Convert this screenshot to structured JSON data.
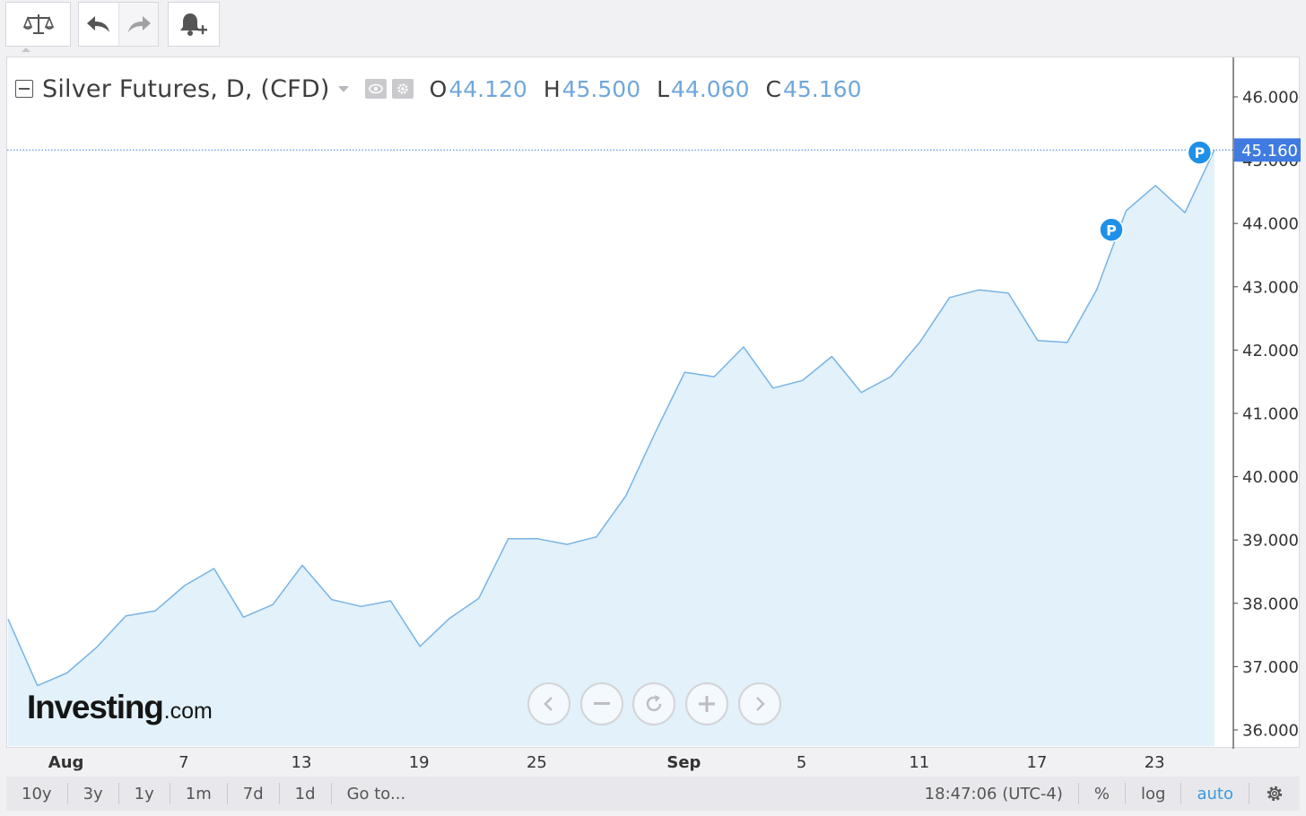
{
  "toolbar": {
    "compare_icon": "scale-icon",
    "undo_icon": "undo-arrow-icon",
    "redo_icon": "redo-arrow-icon",
    "alert_icon": "bell-plus-icon"
  },
  "legend": {
    "title": "Silver Futures, D, (CFD)",
    "open_label": "O",
    "open_value": "44.120",
    "high_label": "H",
    "high_value": "45.500",
    "low_label": "L",
    "low_value": "44.060",
    "close_label": "C",
    "close_value": "45.160"
  },
  "logo": {
    "main": "Investing",
    "suffix": ".com"
  },
  "colors": {
    "line": "#78b3e4",
    "fill": "#e2f1fa",
    "price_tag": "#3f7be0",
    "marker": "#1e90e8",
    "ohlc_value": "#70a7dc"
  },
  "chart_data": {
    "type": "area",
    "symbol": "Silver Futures, D, (CFD)",
    "y_ticks": [
      "36.000",
      "37.000",
      "38.000",
      "39.000",
      "40.000",
      "41.000",
      "42.000",
      "43.000",
      "44.000",
      "45.000",
      "46.000"
    ],
    "ylim": [
      35.7,
      46.4
    ],
    "x_tick_labels": [
      {
        "label": "Aug",
        "bold": true,
        "index": 2
      },
      {
        "label": "7",
        "bold": false,
        "index": 6
      },
      {
        "label": "13",
        "bold": false,
        "index": 10
      },
      {
        "label": "19",
        "bold": false,
        "index": 14
      },
      {
        "label": "25",
        "bold": false,
        "index": 18
      },
      {
        "label": "Sep",
        "bold": true,
        "index": 23
      },
      {
        "label": "5",
        "bold": false,
        "index": 27
      },
      {
        "label": "11",
        "bold": false,
        "index": 31
      },
      {
        "label": "17",
        "bold": false,
        "index": 35
      },
      {
        "label": "23",
        "bold": false,
        "index": 39
      }
    ],
    "values": [
      37.75,
      36.7,
      36.9,
      37.3,
      37.8,
      37.88,
      38.28,
      38.55,
      37.78,
      37.98,
      38.6,
      38.06,
      37.95,
      38.04,
      37.32,
      37.76,
      38.08,
      39.02,
      39.02,
      38.93,
      39.05,
      39.7,
      40.7,
      41.65,
      41.58,
      42.05,
      41.4,
      41.52,
      41.9,
      41.33,
      41.58,
      42.13,
      42.83,
      42.95,
      42.9,
      42.15,
      42.12,
      42.95,
      44.2,
      44.6,
      44.17,
      45.16
    ],
    "current_price": "45.160",
    "markers": [
      {
        "label": "P",
        "index": 37.5,
        "value": 43.9
      },
      {
        "label": "P",
        "index": 40.5,
        "value": 45.12
      }
    ]
  },
  "bottom_bar": {
    "ranges": [
      "10y",
      "3y",
      "1y",
      "1m",
      "7d",
      "1d"
    ],
    "goto": "Go to...",
    "time": "18:47:06 (UTC-4)",
    "percent": "%",
    "log": "log",
    "auto": "auto",
    "settings_icon": "gear-icon"
  },
  "nav": {
    "left_icon": "chevron-left-icon",
    "zoom_out_icon": "minus-icon",
    "reset_icon": "reset-icon",
    "zoom_in_icon": "plus-icon",
    "right_icon": "chevron-right-icon"
  }
}
